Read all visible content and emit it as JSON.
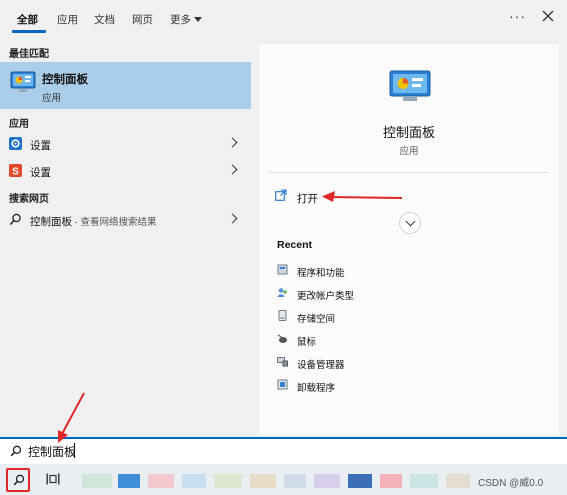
{
  "tabs": [
    {
      "label": "全部",
      "active": true
    },
    {
      "label": "应用",
      "active": false
    },
    {
      "label": "文档",
      "active": false
    },
    {
      "label": "网页",
      "active": false
    },
    {
      "label": "更多",
      "active": false
    }
  ],
  "top_actions": {
    "more_icon": "more-dots-icon",
    "close_icon": "close-icon",
    "dots": "···"
  },
  "results": {
    "best_match_header": "最佳匹配",
    "best_match": {
      "title": "控制面板",
      "subtitle": "应用",
      "icon": "control-panel-icon"
    },
    "apps_header": "应用",
    "apps": [
      {
        "label": "设置",
        "icon": "settings-gear-icon"
      },
      {
        "label": "设置",
        "icon": "s-app-icon"
      }
    ],
    "web_header": "搜索网页",
    "web": [
      {
        "label": "控制面板",
        "sub": " - 查看网络搜索结果",
        "icon": "search-icon"
      }
    ]
  },
  "preview": {
    "title": "控制面板",
    "subtitle": "应用",
    "open_label": "打开",
    "recent_title": "Recent",
    "recent": [
      {
        "label": "程序和功能"
      },
      {
        "label": "更改帐户类型"
      },
      {
        "label": "存储空间"
      },
      {
        "label": "鼠标"
      },
      {
        "label": "设备管理器"
      },
      {
        "label": "卸载程序"
      }
    ]
  },
  "search": {
    "value": "控制面板"
  },
  "taskbar": {
    "watermark": "CSDN @威0.0"
  },
  "colors": {
    "accent": "#0067c0",
    "highlight": "#aacde9",
    "annotation_red": "#e02828",
    "background": "#f0f0f0",
    "card": "#fbfbfb"
  }
}
